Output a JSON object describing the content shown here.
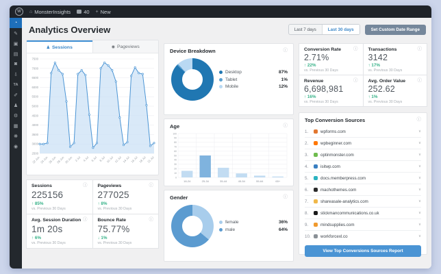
{
  "admin_bar": {
    "wp": "W",
    "site_name": "MonsterInsights",
    "comments_count": "40",
    "new_label": "New",
    "plus": "+"
  },
  "sidebar": {
    "items": [
      {
        "name": "dashboard",
        "glyph": "◔",
        "active": true
      },
      {
        "name": "posts",
        "glyph": "✎",
        "active": false
      },
      {
        "name": "media",
        "glyph": "▣",
        "active": false
      },
      {
        "name": "pages",
        "glyph": "▤",
        "active": false
      },
      {
        "name": "comments",
        "glyph": "◙",
        "active": false
      },
      {
        "name": "downloads",
        "glyph": "⇩",
        "active": false
      },
      {
        "name": "ta-plugin",
        "glyph": "TA",
        "active": false
      },
      {
        "name": "appearance",
        "glyph": "✐",
        "active": false
      },
      {
        "name": "users",
        "glyph": "♟",
        "active": false
      },
      {
        "name": "tools",
        "glyph": "⚙",
        "active": false
      },
      {
        "name": "settings",
        "glyph": "▦",
        "active": false
      },
      {
        "name": "monsterinsights",
        "glyph": "❋",
        "active": false
      },
      {
        "name": "collapse",
        "glyph": "◉",
        "active": false
      }
    ]
  },
  "header": {
    "title": "Analytics Overview",
    "range_buttons": [
      {
        "label": "Last 7 days",
        "active": false
      },
      {
        "label": "Last 30 days",
        "active": true
      }
    ],
    "custom_button": "Set Custom Date Range"
  },
  "tabs": [
    {
      "label": "Sessions",
      "active": true,
      "icon": "person-icon",
      "glyph": "♟"
    },
    {
      "label": "Pageviews",
      "active": false,
      "icon": "eye-icon",
      "glyph": "◉"
    }
  ],
  "chart_data": [
    {
      "id": "sessions",
      "type": "line",
      "title": "Sessions (last 30 days)",
      "x_ticks": [
        "22 Jun",
        "24 Jun",
        "26 Jun",
        "28 Jun",
        "30 Jun",
        "2 Jul",
        "4 Jul",
        "6 Jul",
        "8 Jul",
        "10 Jul",
        "12 Jul",
        "14 Jul",
        "16 Jul",
        "18 Jul",
        "21 Jul"
      ],
      "values": [
        3000,
        3000,
        3050,
        6750,
        7300,
        6900,
        6700,
        5250,
        2850,
        3050,
        6700,
        6900,
        6650,
        4550,
        2800,
        3050,
        7000,
        7300,
        7150,
        6900,
        6300,
        4400,
        2950,
        3100,
        6600,
        7050,
        6750,
        6700,
        5050,
        2900,
        3050
      ],
      "ylim": [
        2500,
        7500
      ],
      "ytick_step": 500,
      "grid": true,
      "color": "#4a94d4",
      "fill": "#c9e0f5"
    },
    {
      "id": "device",
      "type": "pie",
      "title": "Device Breakdown",
      "slices": [
        {
          "label": "Desktop",
          "value": 87,
          "pct": "87%",
          "color": "#2077b2"
        },
        {
          "label": "Tablet",
          "value": 1,
          "pct": "1%",
          "color": "#5ba0d0"
        },
        {
          "label": "Mobile",
          "value": 12,
          "pct": "12%",
          "color": "#b9d9f3"
        }
      ],
      "legend_position": "right"
    },
    {
      "id": "age",
      "type": "bar",
      "title": "Age",
      "categories": [
        "18-24",
        "25-34",
        "35-44",
        "45-54",
        "55-64",
        "65+"
      ],
      "values": [
        15,
        50,
        22,
        9,
        4,
        2
      ],
      "ylim": [
        0,
        100
      ],
      "ytick_step": 10,
      "grid": true,
      "highlight_index": 1,
      "bar_color": "#c2dcf2",
      "highlight_color": "#7fb3de"
    },
    {
      "id": "gender",
      "type": "pie",
      "title": "Gender",
      "slices": [
        {
          "label": "female",
          "value": 36,
          "pct": "36%",
          "color": "#a8cdec"
        },
        {
          "label": "male",
          "value": 64,
          "pct": "64%",
          "color": "#5b9bd0"
        }
      ],
      "legend_position": "right"
    }
  ],
  "left_stats": [
    {
      "label": "Sessions",
      "value": "225156",
      "dir": "up",
      "delta": "85%",
      "note": "vs. Previous 30 Days"
    },
    {
      "label": "Pageviews",
      "value": "277025",
      "dir": "up",
      "delta": "8%",
      "note": "vs. Previous 30 Days"
    },
    {
      "label": "Avg. Session Duration",
      "value": "1m 20s",
      "dir": "up",
      "delta": "6%",
      "note": "vs. Previous 30 Days"
    },
    {
      "label": "Bounce Rate",
      "value": "75.77%",
      "dir": "down",
      "delta": "1%",
      "note": "vs. Previous 30 Days"
    }
  ],
  "right_stats": [
    {
      "label": "Conversion Rate",
      "value": "2.71%",
      "dir": "up",
      "delta": "22%",
      "note": "vs. Previous 30 Days"
    },
    {
      "label": "Transactions",
      "value": "3142",
      "dir": "up",
      "delta": "17%",
      "note": "vs. Previous 30 Days"
    },
    {
      "label": "Revenue",
      "value": "6,698,981",
      "dir": "up",
      "delta": "16%",
      "note": "vs. Previous 30 Days"
    },
    {
      "label": "Avg. Order Value",
      "value": "252.62",
      "dir": "up",
      "delta": "1%",
      "note": "vs. Previous 30 Days"
    }
  ],
  "sources": {
    "title": "Top Conversion Sources",
    "items": [
      {
        "rank": "1.",
        "domain": "wpforms.com",
        "favicon_color": "#e27730"
      },
      {
        "rank": "2.",
        "domain": "wpbeginner.com",
        "favicon_color": "#ff7700"
      },
      {
        "rank": "3.",
        "domain": "optinmonster.com",
        "favicon_color": "#6fbc4e"
      },
      {
        "rank": "4.",
        "domain": "isitwp.com",
        "favicon_color": "#3a7fc1"
      },
      {
        "rank": "5.",
        "domain": "docs.memberpress.com",
        "favicon_color": "#2bb3c0"
      },
      {
        "rank": "6.",
        "domain": "machothemes.com",
        "favicon_color": "#2b2b2b"
      },
      {
        "rank": "7.",
        "domain": "shareasale-analytics.com",
        "favicon_color": "#f0b84a"
      },
      {
        "rank": "8.",
        "domain": "stickmancommunications.co.uk",
        "favicon_color": "#1a1a1a"
      },
      {
        "rank": "9.",
        "domain": "mindsupplies.com",
        "favicon_color": "#f09a2e"
      },
      {
        "rank": "10.",
        "domain": "workforcexl.co",
        "favicon_color": "#8a9096"
      }
    ],
    "footer_button": "View Top Conversions Sources Report"
  },
  "colors": {
    "positive_green": "#35b187",
    "accent_blue": "#4a94d4",
    "up_arrow": "↑",
    "down_arrow": "↓",
    "info_glyph": "ⓘ",
    "chevron": "∨"
  }
}
